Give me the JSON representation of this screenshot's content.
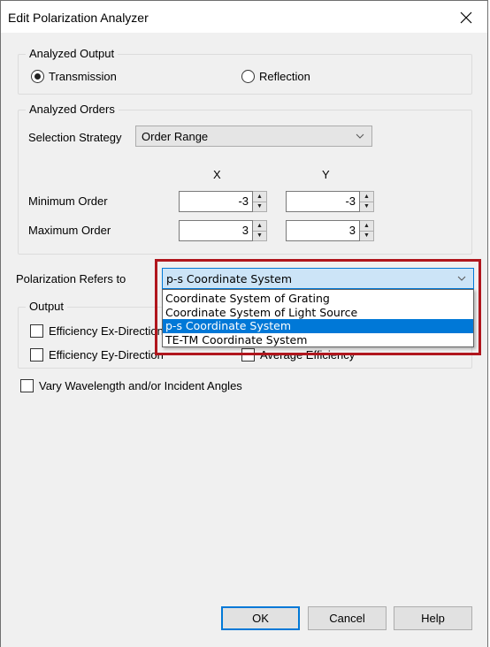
{
  "window": {
    "title": "Edit Polarization Analyzer",
    "close_icon": "close-x-icon"
  },
  "analyzed_output": {
    "group_label": "Analyzed Output",
    "options": [
      {
        "label": "Transmission",
        "selected": true
      },
      {
        "label": "Reflection",
        "selected": false
      }
    ]
  },
  "analyzed_orders": {
    "group_label": "Analyzed Orders",
    "selection_strategy_label": "Selection Strategy",
    "selection_strategy_value": "Order Range",
    "column_x": "X",
    "column_y": "Y",
    "min_order_label": "Minimum Order",
    "max_order_label": "Maximum Order",
    "min_x": "-3",
    "min_y": "-3",
    "max_x": "3",
    "max_y": "3",
    "spin_up": "▲",
    "spin_down": "▼"
  },
  "polarization": {
    "label": "Polarization Refers to",
    "selected_value": "p-s Coordinate System",
    "options": [
      "Coordinate System of Grating",
      "Coordinate System of Light Source",
      "p-s Coordinate System",
      "TE-TM Coordinate System"
    ],
    "highlighted_index": 2,
    "highlight_color": "#b0161d"
  },
  "output": {
    "group_label": "Output",
    "checkboxes": [
      {
        "label": "Efficiency Ex-Direction",
        "checked": false
      },
      {
        "label": "Efficiency Ey-Direction",
        "checked": false
      },
      {
        "label": "Average Efficiency",
        "checked": false
      }
    ]
  },
  "vary": {
    "label": "Vary Wavelength and/or Incident Angles",
    "checked": false
  },
  "buttons": {
    "ok": "OK",
    "cancel": "Cancel",
    "help": "Help"
  },
  "colors": {
    "accent": "#0078d7",
    "selection_bg": "#0078d7",
    "combo_focus_bg": "#cce4f7",
    "dialog_bg": "#f0f0f0"
  }
}
